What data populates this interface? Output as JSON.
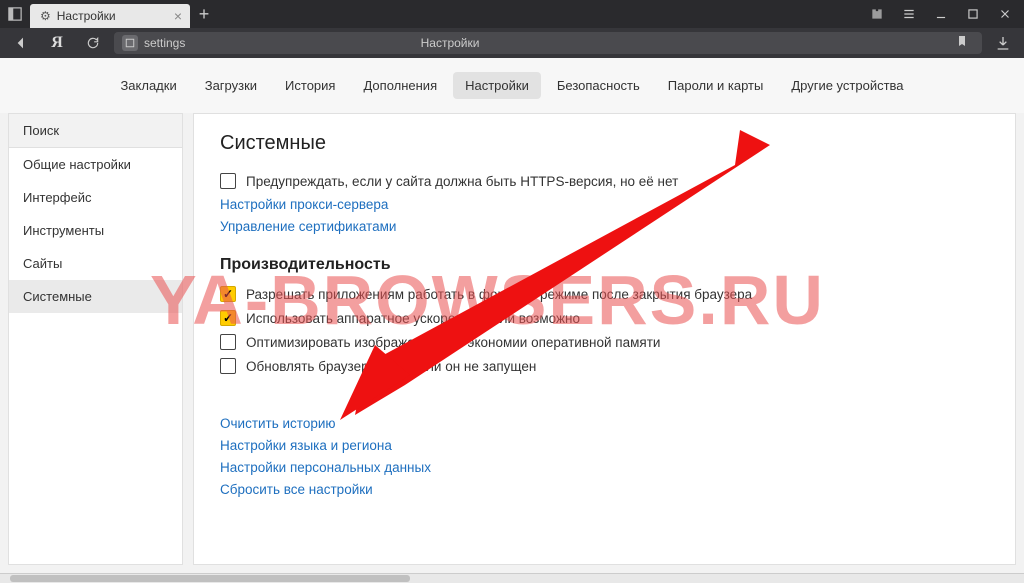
{
  "tab_title": "Настройки",
  "address": {
    "url": "settings",
    "page_title": "Настройки"
  },
  "top_tabs": [
    {
      "label": "Закладки"
    },
    {
      "label": "Загрузки"
    },
    {
      "label": "История"
    },
    {
      "label": "Дополнения"
    },
    {
      "label": "Настройки",
      "active": true
    },
    {
      "label": "Безопасность"
    },
    {
      "label": "Пароли и карты"
    },
    {
      "label": "Другие устройства"
    }
  ],
  "sidebar": [
    {
      "label": "Поиск",
      "kind": "search"
    },
    {
      "label": "Общие настройки"
    },
    {
      "label": "Интерфейс"
    },
    {
      "label": "Инструменты"
    },
    {
      "label": "Сайты"
    },
    {
      "label": "Системные",
      "active": true
    }
  ],
  "main": {
    "section_title": "Системные",
    "warn_https": {
      "label": "Предупреждать, если у сайта должна быть HTTPS-версия, но её нет",
      "checked": false
    },
    "proxy_link": "Настройки прокси-сервера",
    "cert_link": "Управление сертификатами",
    "perf_title": "Производительность",
    "bg_apps": {
      "label": "Разрешать приложениям работать в фоновом режиме после закрытия браузера",
      "checked": true
    },
    "hw_accel": {
      "label": "Использовать аппаратное ускорение, если возможно",
      "checked": true
    },
    "optimize_img": {
      "label": "Оптимизировать изображения для экономии оперативной памяти",
      "checked": false
    },
    "auto_update": {
      "label": "Обновлять браузер, даже если он не запущен",
      "checked": false
    },
    "links": {
      "clear_history": "Очистить историю",
      "lang_region": "Настройки языка и региона",
      "personal": "Настройки персональных данных",
      "reset": "Сбросить все настройки"
    }
  },
  "watermark": "YA-BROWSERS.RU"
}
